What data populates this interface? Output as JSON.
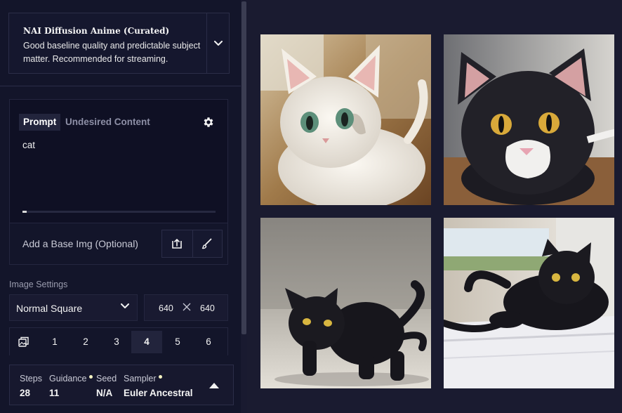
{
  "model": {
    "name": "NAI Diffusion Anime (Curated)",
    "description": "Good baseline quality and predictable subject matter. Recommended for streaming.",
    "toggle_icon": "chevron-down-icon"
  },
  "prompt": {
    "tabs": [
      {
        "label": "Prompt",
        "active": true
      },
      {
        "label": "Undesired Content",
        "active": false
      }
    ],
    "settings_icon": "gear-icon",
    "value": "cat",
    "token_usage": 0.02
  },
  "base_image": {
    "label": "Add a Base Img (Optional)",
    "upload_icon": "upload-icon",
    "paint_icon": "paintbrush-icon"
  },
  "image_settings": {
    "label": "Image Settings",
    "size_preset": "Normal Square",
    "width": "640",
    "height": "640",
    "multiply_icon": "times-icon"
  },
  "image_count": {
    "icon": "images-stack-icon",
    "options": [
      "1",
      "2",
      "3",
      "4",
      "5",
      "6"
    ],
    "selected": "4"
  },
  "generation": {
    "steps": {
      "label": "Steps",
      "value": "28"
    },
    "guidance": {
      "label": "Guidance",
      "value": "11"
    },
    "seed": {
      "label": "Seed",
      "value": "N/A"
    },
    "sampler": {
      "label": "Sampler",
      "value": "Euler Ancestral"
    },
    "indicator_color": "#f5f3c2",
    "collapse_icon": "caret-up-icon"
  },
  "gallery": {
    "images": [
      {
        "name": "image-white-kitten"
      },
      {
        "name": "image-black-cat-closeup"
      },
      {
        "name": "image-black-cat-crouching"
      },
      {
        "name": "image-black-cat-on-bed"
      }
    ]
  },
  "colors": {
    "background": "#1a1b30",
    "sidebar": "#13152a",
    "panel": "#0f1024",
    "border": "#2b2d48",
    "accent": "#f5f3c2"
  }
}
